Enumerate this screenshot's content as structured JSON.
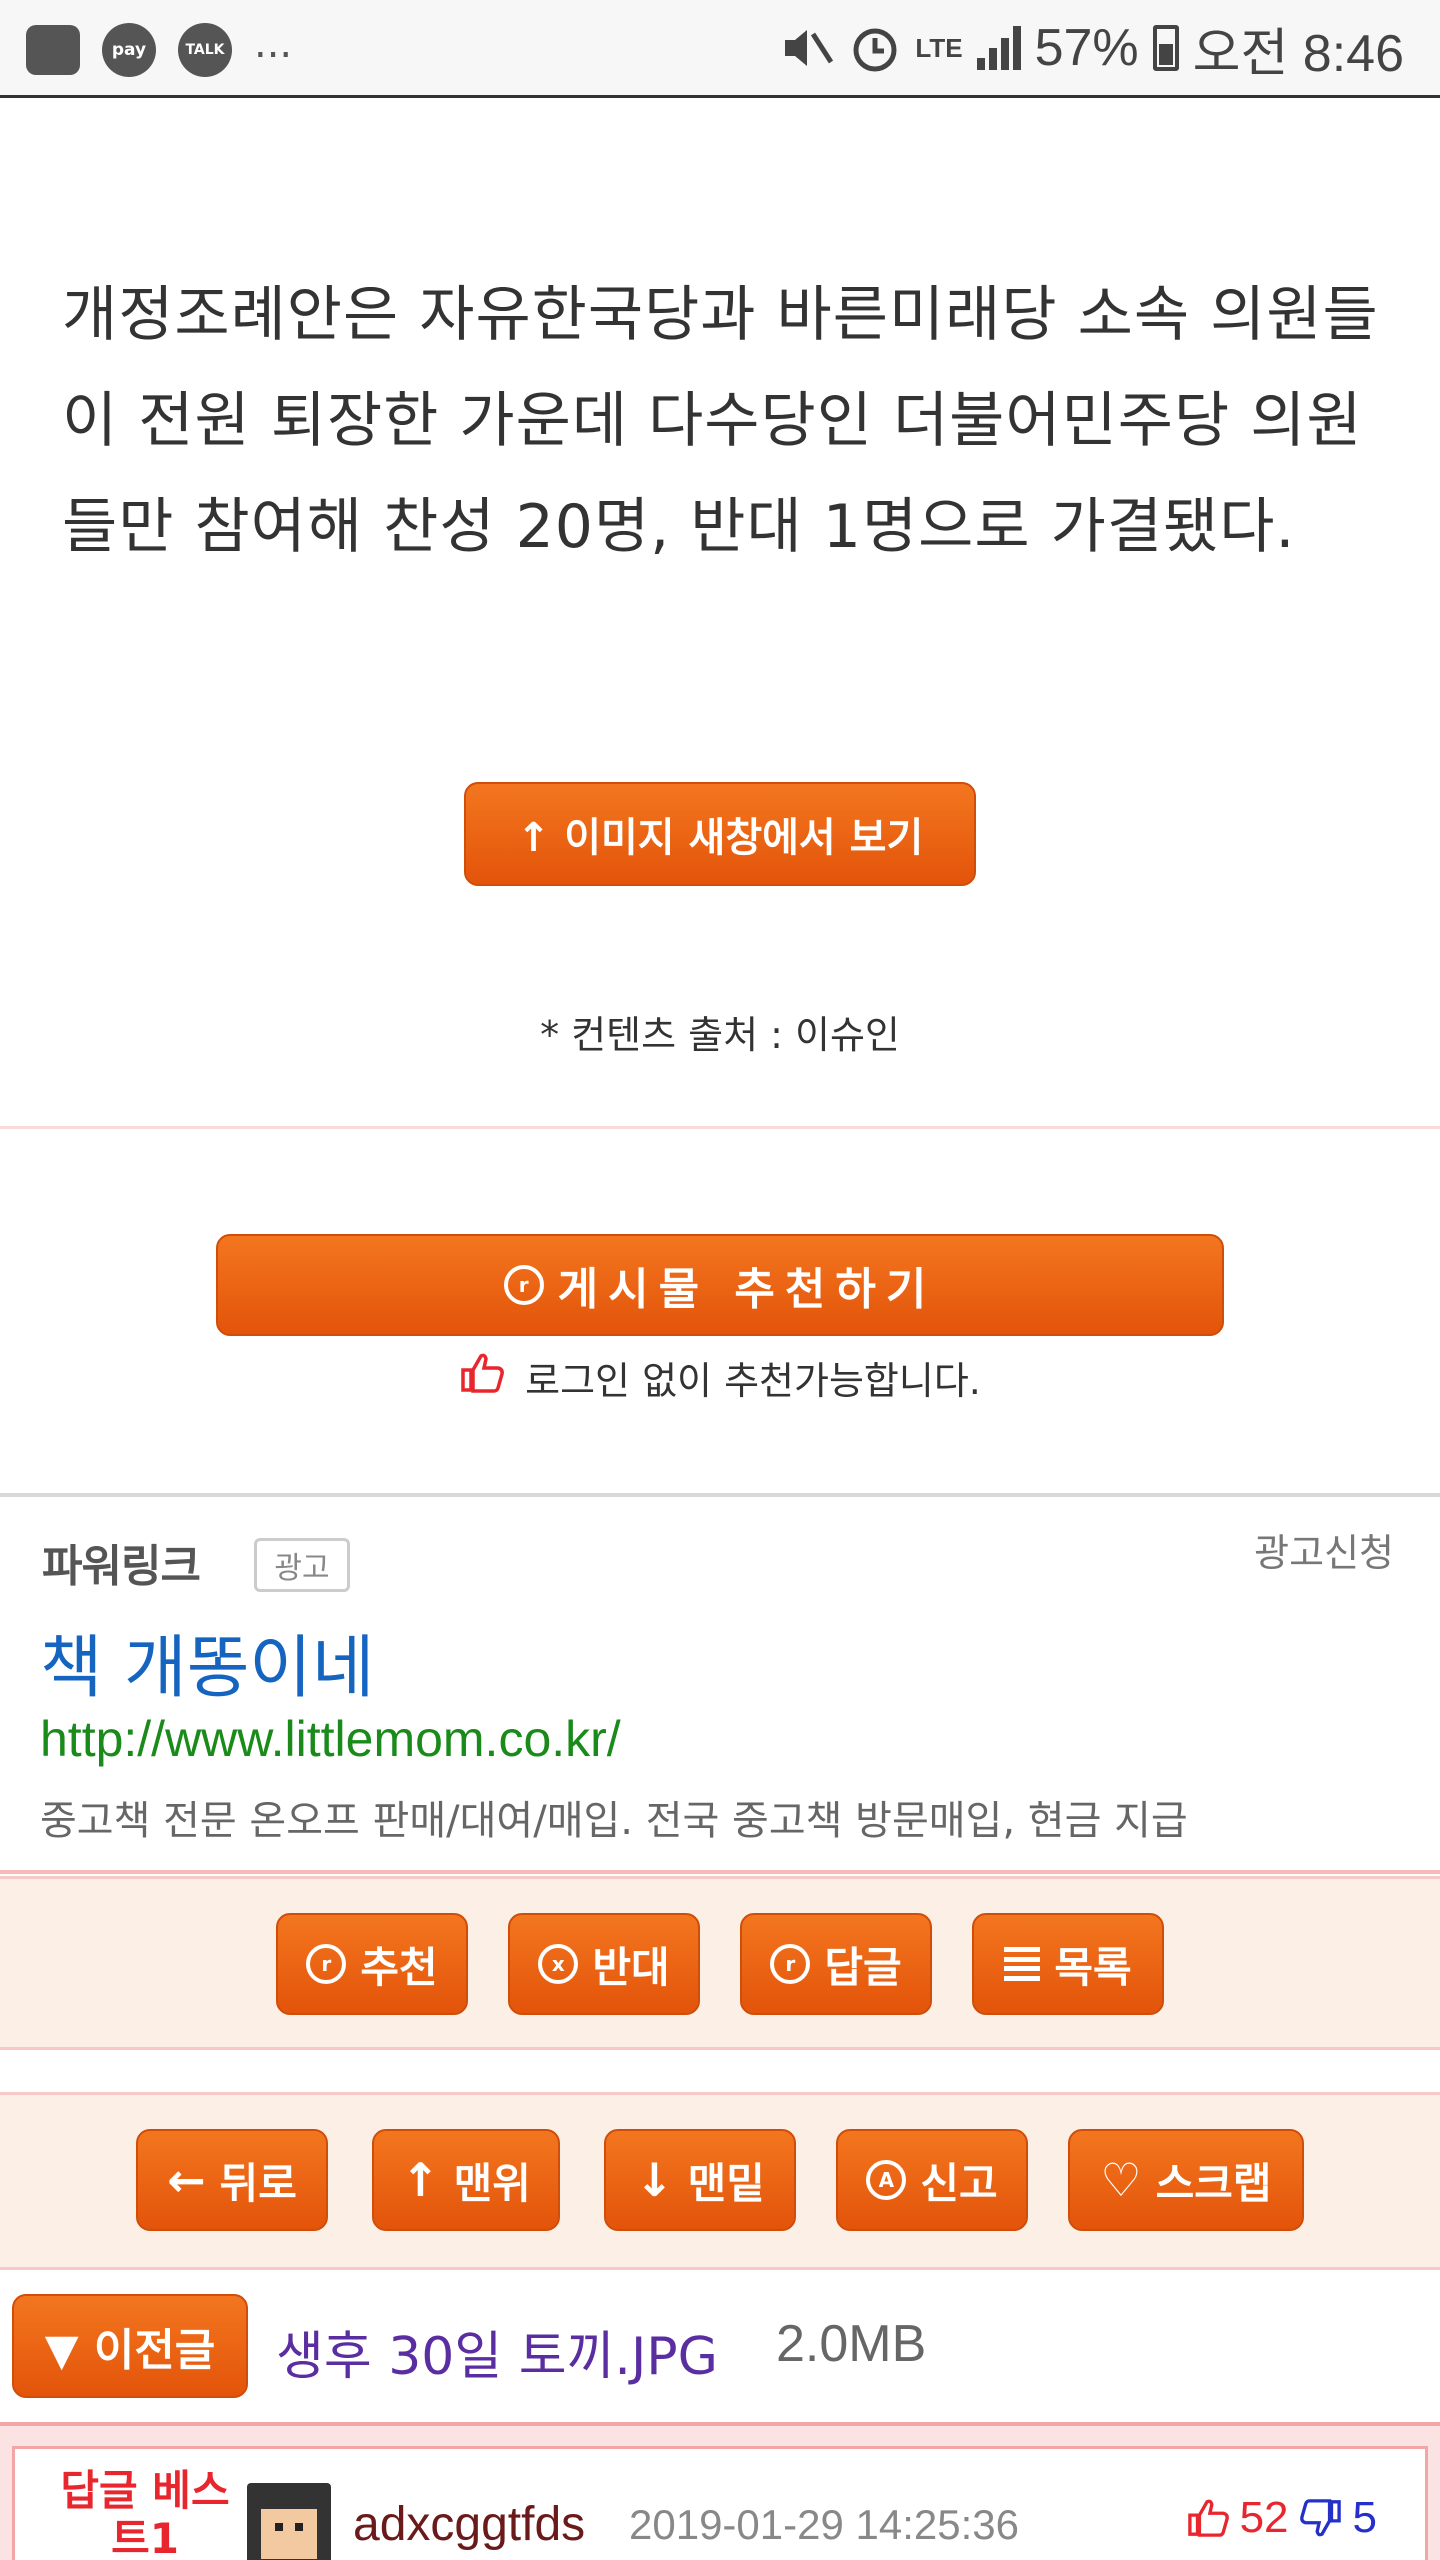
{
  "status_bar": {
    "pay_icon_label": "pay",
    "talk_icon_label": "TALK",
    "overflow": "...",
    "network": "LTE",
    "battery": "57%",
    "time": "오전 8:46"
  },
  "article": {
    "body": "개정조례안은 자유한국당과 바른미래당 소속 의원들이 전원 퇴장한 가운데 다수당인 더불어민주당 의원들만 참여해 찬성 20명, 반대 1명으로 가결됐다.",
    "view_image_button": "↑ 이미지 새창에서 보기",
    "source": "* 컨텐츠 출처 : 이슈인"
  },
  "recommend": {
    "icon_glyph": "r",
    "button_label": "게시물  추천하기",
    "note": "로그인 없이 추천가능합니다."
  },
  "ad": {
    "section_title": "파워링크",
    "badge": "광고",
    "apply_link": "광고신청",
    "headline": "책 개똥이네",
    "url": "http://www.littlemom.co.kr/",
    "description": "중고책 전문 온오프 판매/대여/매입. 전국 중고책 방문매입, 현금 지급"
  },
  "actions_row1": {
    "recommend_glyph": "r",
    "recommend": "추천",
    "oppose_glyph": "x",
    "oppose": "반대",
    "reply_glyph": "r",
    "reply": "답글",
    "list": "목록"
  },
  "actions_row2": {
    "back_arrow": "←",
    "back": "뒤로",
    "top_arrow": "↑",
    "top": "맨위",
    "bottom_arrow": "↓",
    "bottom": "맨밑",
    "report_glyph": "A",
    "report": "신고",
    "scrap_glyph": "♡",
    "scrap": "스크랩"
  },
  "prev_post": {
    "button": "▼ 이전글",
    "title": "생후 30일 토끼.JPG",
    "size": "2.0MB"
  },
  "best_reply": {
    "label": "답글 베스트1",
    "username": "adxcggtfds",
    "date": "2019-01-29 14:25:36",
    "upvotes": "52",
    "downvotes": "5"
  },
  "colors": {
    "accent_orange": "#e85a0c",
    "link_blue": "#1464c0",
    "url_green": "#1a8a1a",
    "visited_purple": "#5a2ea0",
    "vote_red": "#e8262e",
    "vote_blue": "#2430c8"
  }
}
